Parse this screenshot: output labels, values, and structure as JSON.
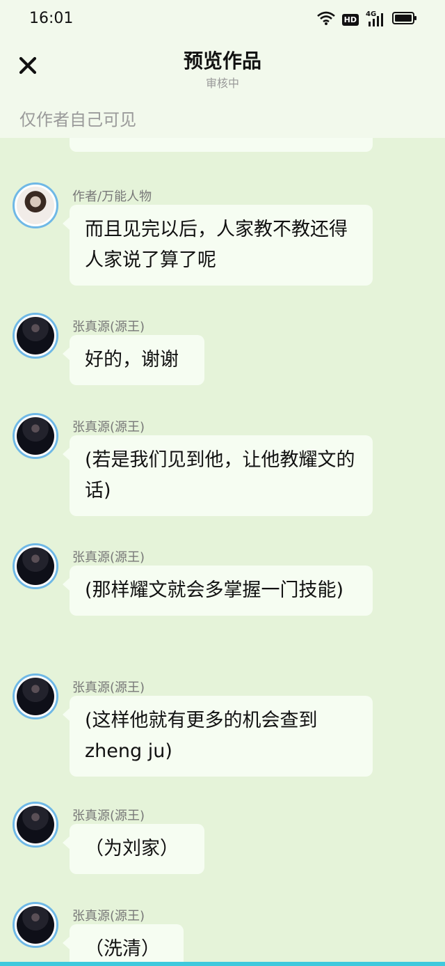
{
  "status_bar": {
    "time": "16:01",
    "wifi_icon": "wifi-icon",
    "hd_label": "HD",
    "network_label": "4G",
    "battery_icon": "battery-icon"
  },
  "header": {
    "title": "预览作品",
    "subtitle": "审核中",
    "close_icon": "close-icon"
  },
  "notice": "仅作者自己可见",
  "colors": {
    "background": "#e5f3d9",
    "header_background": "#f2f9ec",
    "bubble": "#f6fdf2",
    "avatar_ring": "#6fb8e6",
    "bottom_bar": "#3fc9dd"
  },
  "messages": [
    {
      "name": "作者/万能人物",
      "text": "而且见完以后，人家教不教还得人家说了算了呢"
    },
    {
      "name": "张真源(源王)",
      "text": "好的，谢谢"
    },
    {
      "name": "张真源(源王)",
      "text": "(若是我们见到他，让他教耀文的话)"
    },
    {
      "name": "张真源(源王)",
      "text": "(那样耀文就会多掌握一门技能)"
    },
    {
      "name": "张真源(源王)",
      "text": "(这样他就有更多的机会查到zheng ju)"
    },
    {
      "name": "张真源(源王)",
      "text": "（为刘家）"
    },
    {
      "name": "张真源(源王)",
      "text": "（洗清）"
    }
  ]
}
